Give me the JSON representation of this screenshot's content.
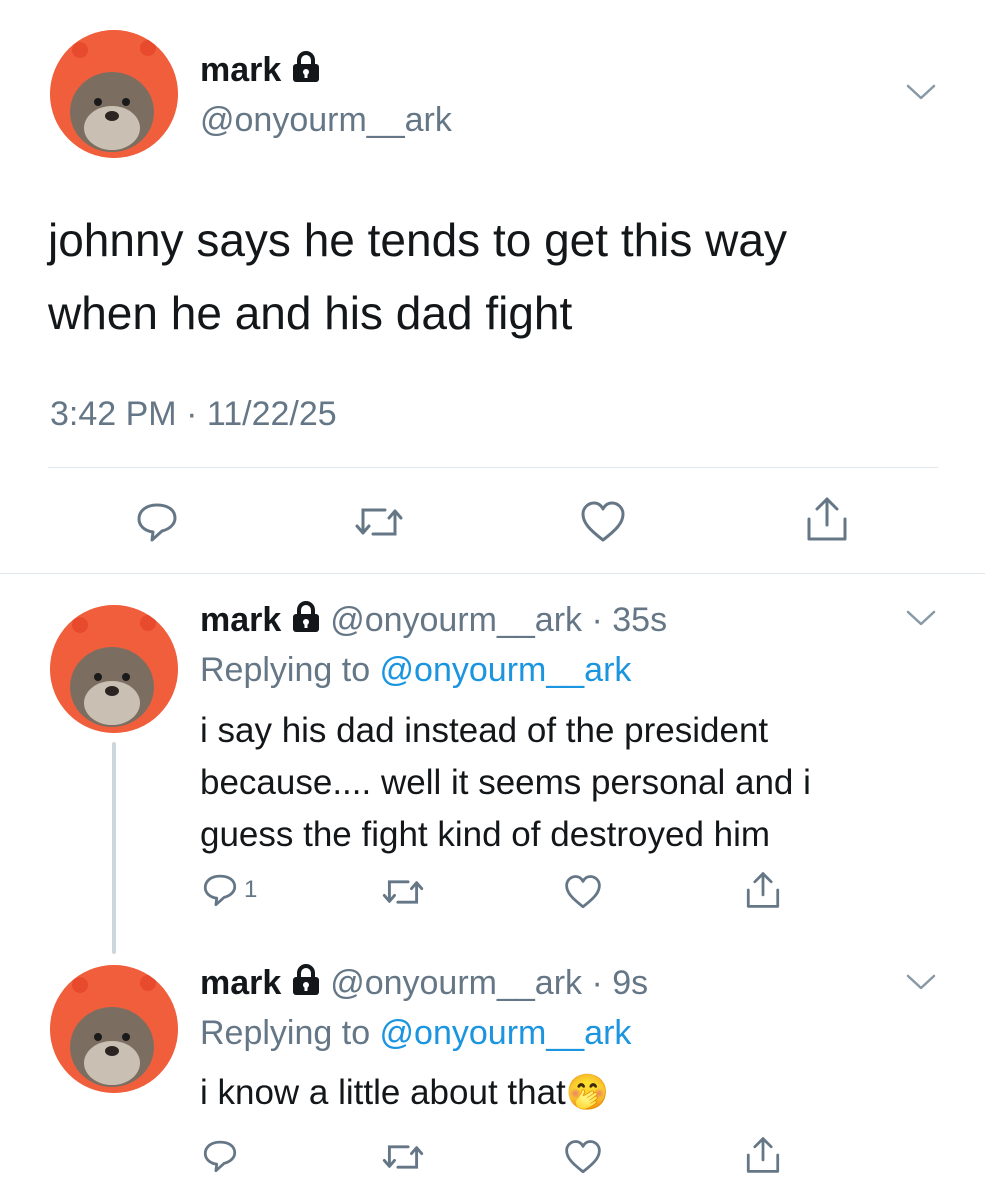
{
  "main_tweet": {
    "display_name": "mark",
    "handle": "@onyourm__ark",
    "text_line1": "johnny says he tends to get this way",
    "text_line2": "when he and his dad fight",
    "timestamp": "3:42 PM · 11/22/25"
  },
  "replies": [
    {
      "display_name": "mark",
      "handle_time": "@onyourm__ark · 35s",
      "replying_prefix": "Replying to ",
      "replying_to": "@onyourm__ark",
      "text_line1": "i say his dad instead of the president",
      "text_line2": "because.... well it seems personal and i",
      "text_line3": "guess the fight kind of destroyed him",
      "reply_count": "1"
    },
    {
      "display_name": "mark",
      "handle_time": "@onyourm__ark · 9s",
      "replying_prefix": "Replying to ",
      "replying_to": "@onyourm__ark",
      "text_line1": "i know a little about that",
      "emoji": "🤭",
      "reply_count": ""
    }
  ],
  "icons": {
    "lock": "lock-icon",
    "chevron": "chevron-down-icon",
    "reply": "reply-icon",
    "retweet": "retweet-icon",
    "like": "heart-icon",
    "share": "share-icon"
  },
  "colors": {
    "text": "#14171a",
    "secondary": "#657786",
    "link": "#1b95e0",
    "divider": "#e1e8ed",
    "thread_line": "#ccd6dd"
  }
}
